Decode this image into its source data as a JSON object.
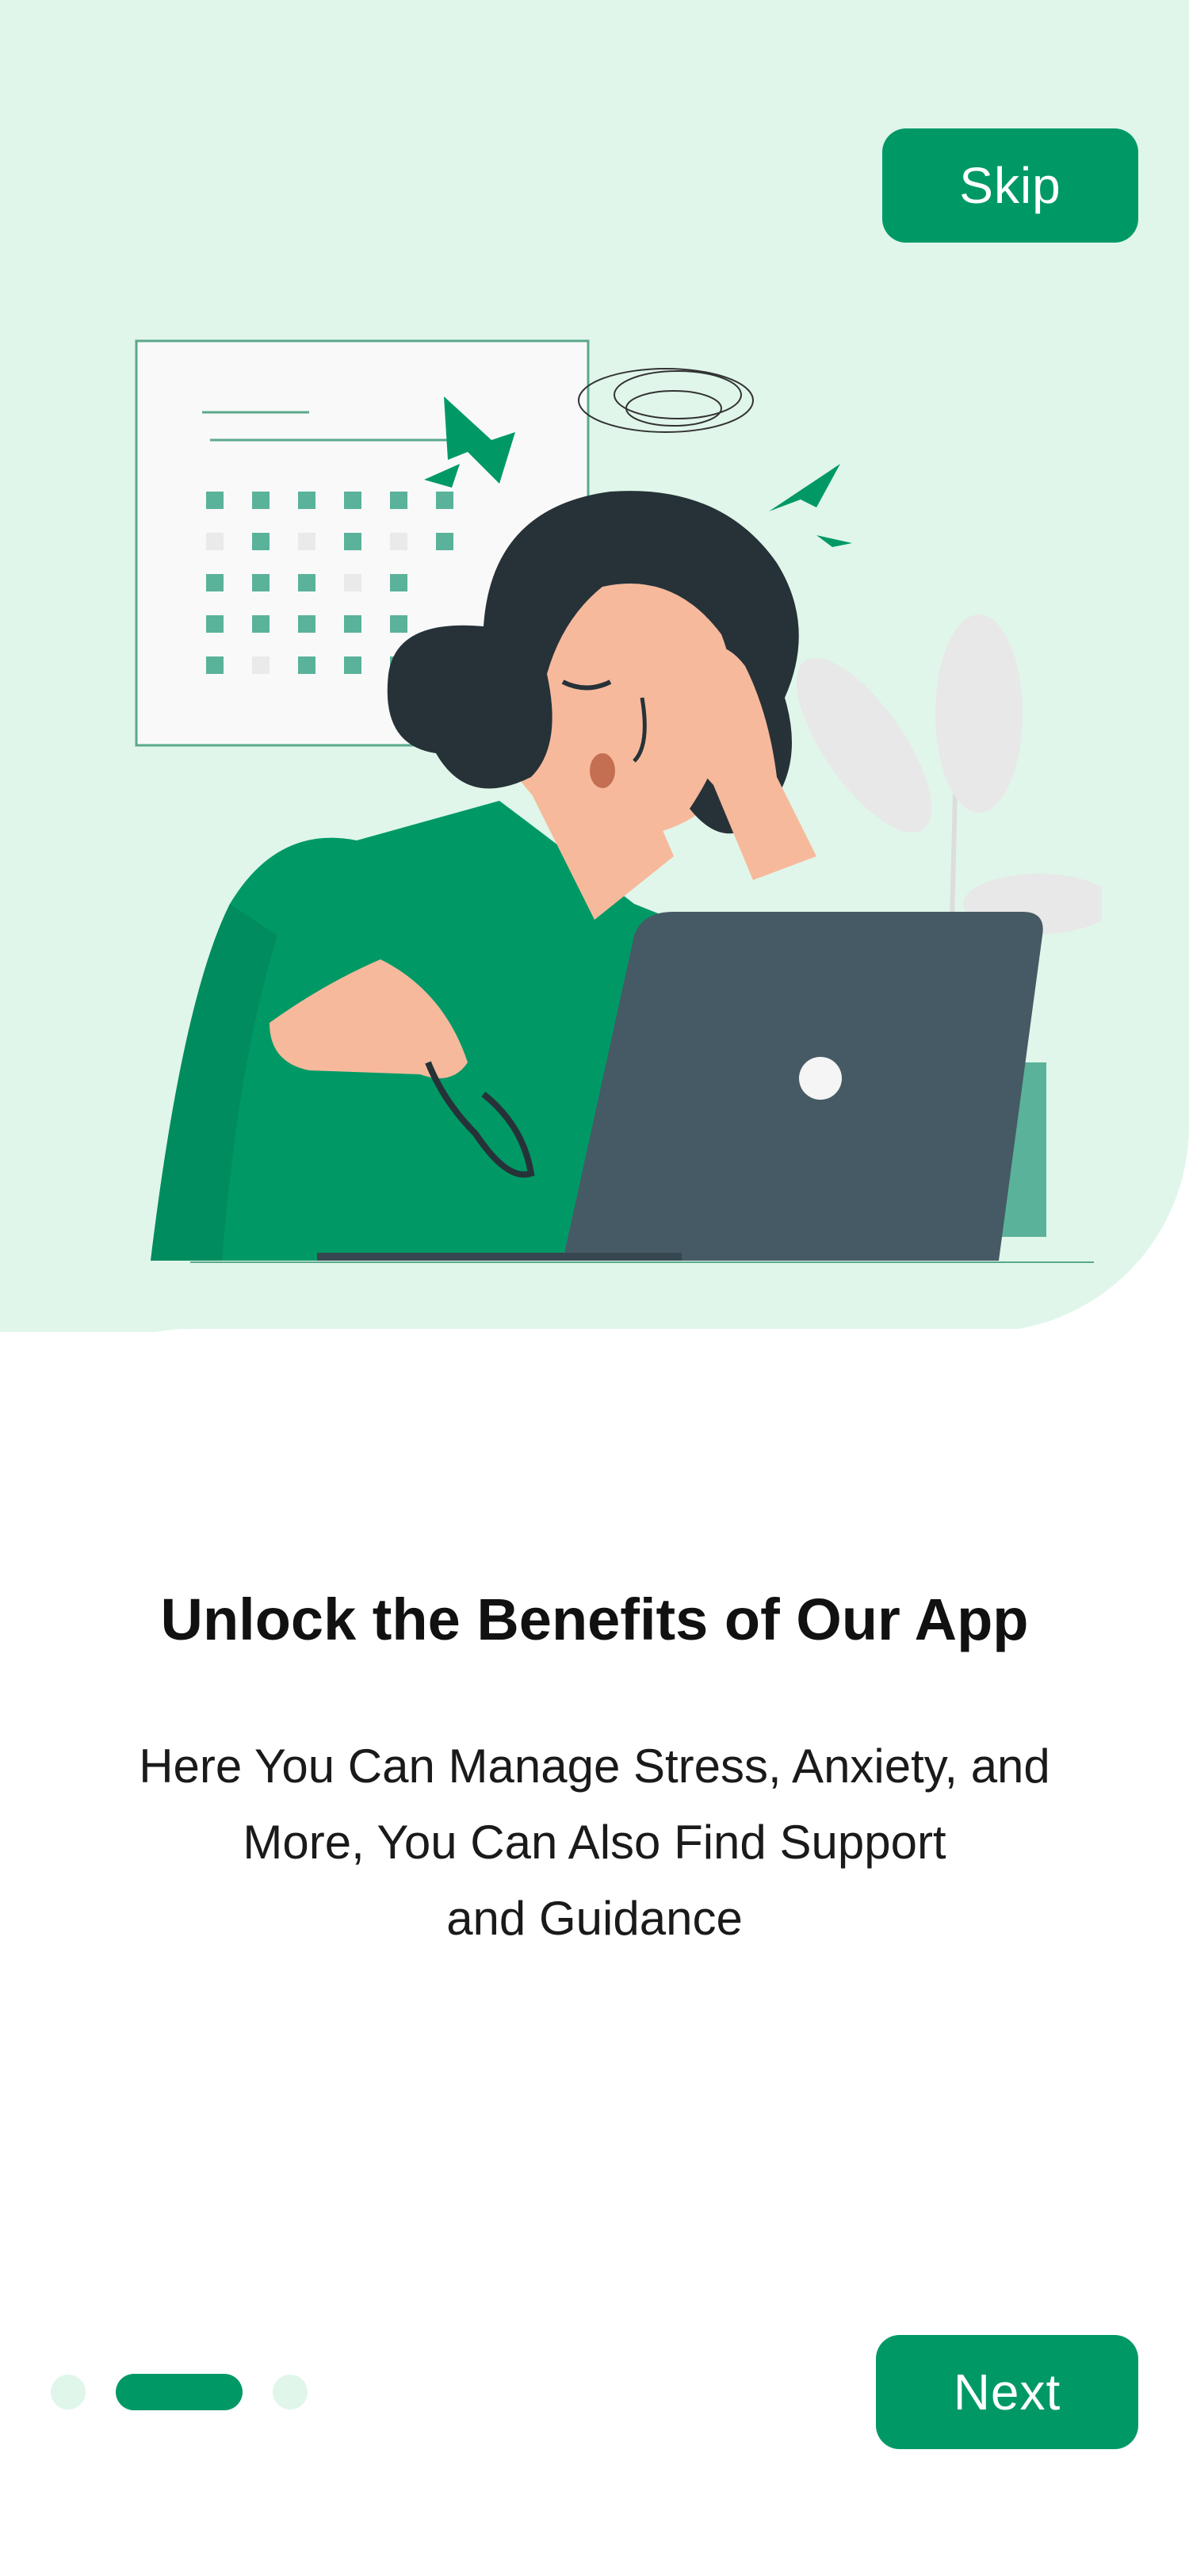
{
  "header": {
    "skip_label": "Skip"
  },
  "illustration": {
    "name": "stressed-person-at-laptop-illustration"
  },
  "content": {
    "title": "Unlock the Benefits of Our App",
    "description_lines": [
      "Here You Can Manage Stress, Anxiety, and",
      "More, You Can Also Find Support",
      "and Guidance"
    ]
  },
  "footer": {
    "next_label": "Next",
    "pagination": {
      "total": 3,
      "current": 2
    }
  },
  "colors": {
    "accent": "#009966",
    "top_background": "#e0f6ea",
    "inactive_dot": "#e0f6ea",
    "title_text": "#111111"
  }
}
